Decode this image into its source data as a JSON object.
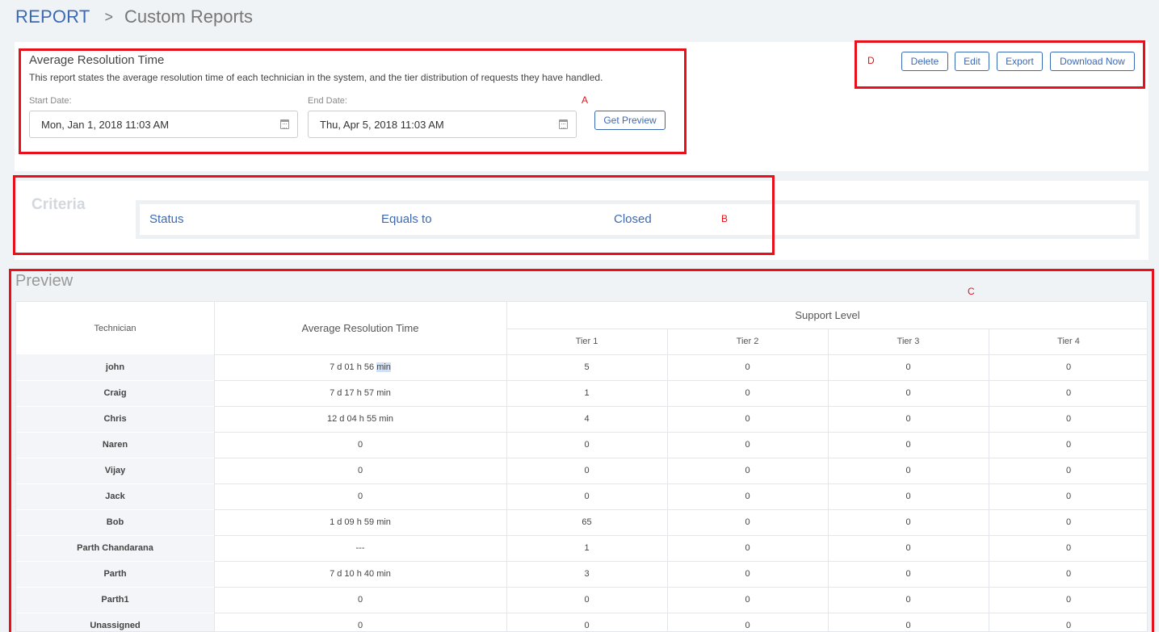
{
  "breadcrumb": {
    "root": "REPORT",
    "separator": ">",
    "current": "Custom Reports"
  },
  "report": {
    "title": "Average Resolution Time",
    "description": "This report states the average resolution time of each technician in the system, and the tier distribution of requests they have handled.",
    "start_label": "Start Date:",
    "start_value": "Mon, Jan 1, 2018 11:03 AM",
    "end_label": "End Date:",
    "end_value": "Thu, Apr 5, 2018 11:03 AM",
    "preview_button": "Get Preview"
  },
  "actions": {
    "delete": "Delete",
    "edit": "Edit",
    "export": "Export",
    "download": "Download Now"
  },
  "annotations": {
    "a": "A",
    "b": "B",
    "c": "C",
    "d": "D"
  },
  "criteria": {
    "title": "Criteria",
    "field": "Status",
    "operator": "Equals to",
    "value": "Closed"
  },
  "preview": {
    "title": "Preview",
    "headers": {
      "technician": "Technician",
      "avg_time": "Average Resolution Time",
      "support_level": "Support Level",
      "tiers": [
        "Tier 1",
        "Tier 2",
        "Tier 3",
        "Tier 4"
      ]
    },
    "rows": [
      {
        "name": "john",
        "time_main": "7 d 01 h 56",
        "time_unit": "min",
        "tiers": [
          "5",
          "0",
          "0",
          "0"
        ]
      },
      {
        "name": "Craig",
        "time_main": "7 d 17 h 57",
        "time_unit": "min",
        "tiers": [
          "1",
          "0",
          "0",
          "0"
        ]
      },
      {
        "name": "Chris",
        "time_main": "12 d 04 h 55",
        "time_unit": "min",
        "tiers": [
          "4",
          "0",
          "0",
          "0"
        ]
      },
      {
        "name": "Naren",
        "time_main": "0",
        "time_unit": "",
        "tiers": [
          "0",
          "0",
          "0",
          "0"
        ]
      },
      {
        "name": "Vijay",
        "time_main": "0",
        "time_unit": "",
        "tiers": [
          "0",
          "0",
          "0",
          "0"
        ]
      },
      {
        "name": "Jack",
        "time_main": "0",
        "time_unit": "",
        "tiers": [
          "0",
          "0",
          "0",
          "0"
        ]
      },
      {
        "name": "Bob",
        "time_main": "1 d 09 h 59",
        "time_unit": "min",
        "tiers": [
          "65",
          "0",
          "0",
          "0"
        ]
      },
      {
        "name": "Parth Chandarana",
        "time_main": "---",
        "time_unit": "",
        "tiers": [
          "1",
          "0",
          "0",
          "0"
        ]
      },
      {
        "name": "Parth",
        "time_main": "7 d 10 h 40",
        "time_unit": "min",
        "tiers": [
          "3",
          "0",
          "0",
          "0"
        ]
      },
      {
        "name": "Parth1",
        "time_main": "0",
        "time_unit": "",
        "tiers": [
          "0",
          "0",
          "0",
          "0"
        ]
      },
      {
        "name": "Unassigned",
        "time_main": "0",
        "time_unit": "",
        "tiers": [
          "0",
          "0",
          "0",
          "0"
        ]
      }
    ]
  }
}
